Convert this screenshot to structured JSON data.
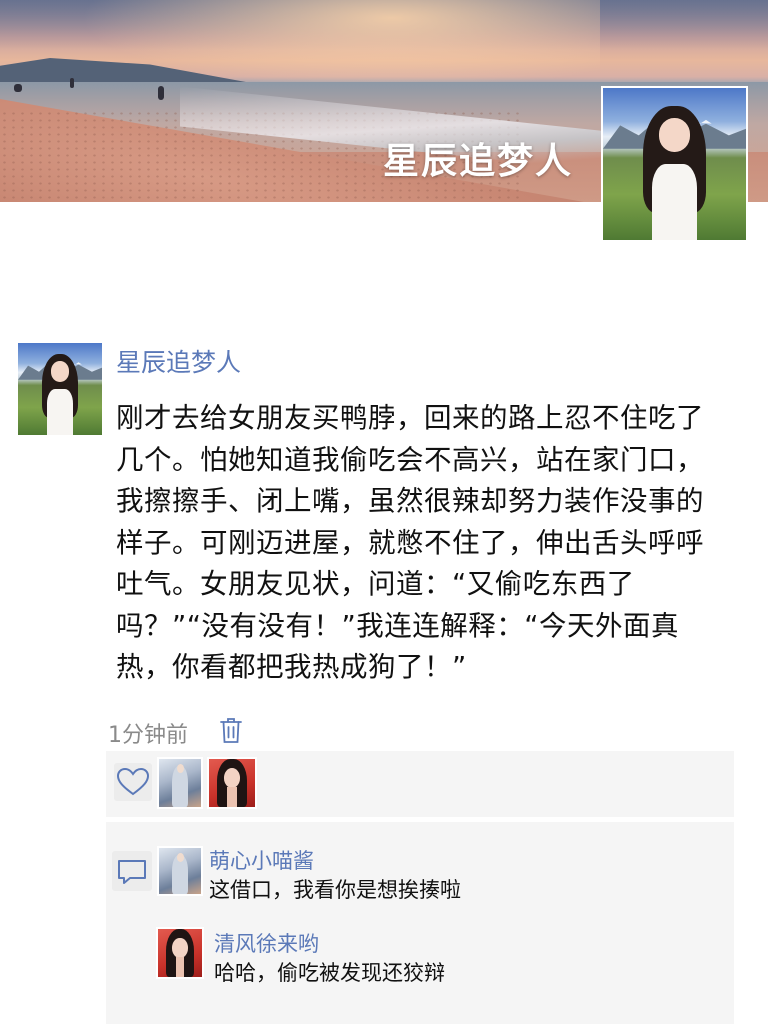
{
  "cover": {
    "title": "星辰追梦人"
  },
  "post": {
    "author": "星辰追梦人",
    "text": "刚才去给女朋友买鸭脖，回来的路上忍不住吃了几个。怕她知道我偷吃会不高兴，站在家门口，我擦擦手、闭上嘴，虽然很辣却努力装作没事的样子。可刚迈进屋，就憋不住了，伸出舌头呼呼吐气。女朋友见状，问道：“又偷吃东西了吗？”“没有没有！”我连连解释：“今天外面真热，你看都把我热成狗了！”",
    "time": "1分钟前"
  },
  "likes": {
    "icon": "heart-icon",
    "avatars": [
      "avatar-blue-illustration",
      "avatar-red-portrait"
    ]
  },
  "comments": [
    {
      "name": "萌心小喵酱",
      "text": "这借口，我看你是想挨揍啦",
      "avatar": "avatar-blue-illustration"
    },
    {
      "name": "清风徐来哟",
      "text": "哈哈，偷吃被发现还狡辩",
      "avatar": "avatar-red-portrait"
    }
  ],
  "colors": {
    "link_blue": "#5b79b8",
    "panel_bg": "#f5f5f5",
    "muted_text": "#8a8a8a"
  }
}
